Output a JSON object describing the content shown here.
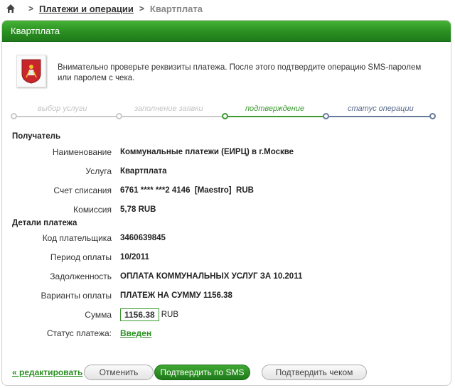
{
  "breadcrumb": {
    "link": "Платежи и операции",
    "current": "Квартплата",
    "separator": ">"
  },
  "panel": {
    "title": "Квартплата",
    "info": "Внимательно проверьте реквизиты платежа. После этого подтвердите операцию SMS-паролем или паролем с чека."
  },
  "steps": [
    {
      "label": "выбор услуги",
      "state": "done"
    },
    {
      "label": "заполнение заявки",
      "state": "done"
    },
    {
      "label": "подтверждение",
      "state": "active"
    },
    {
      "label": "статус операции",
      "state": "pending"
    }
  ],
  "recipient": {
    "title": "Получатель",
    "fields": [
      {
        "label": "Наименование",
        "value": "Коммунальные платежи (ЕИРЦ) в г.Москве"
      },
      {
        "label": "Услуга",
        "value": "Квартплата"
      },
      {
        "label": "Счет списания",
        "value": "6761 **** ***2 4146  [Maestro]  RUB"
      },
      {
        "label": "Комиссия",
        "value": "5,78 RUB"
      }
    ]
  },
  "details": {
    "title": "Детали платежа",
    "fields": [
      {
        "label": "Код плательщика",
        "value": "3460639845"
      },
      {
        "label": "Период оплаты",
        "value": "10/2011"
      },
      {
        "label": "Задолженность",
        "value": "ОПЛАТА КОММУНАЛЬНЫХ УСЛУГ ЗА 10.2011"
      },
      {
        "label": "Варианты оплаты",
        "value": "ПЛАТЕЖ НА СУММУ 1156.38"
      }
    ],
    "sum_label": "Сумма",
    "sum_value": "1156.38",
    "sum_currency": "RUB",
    "status_label": "Статус платежа:",
    "status_value": "Введен"
  },
  "footer": {
    "edit": "« редактировать",
    "cancel": "Отменить",
    "confirm_sms": "Подтвердить по SMS",
    "confirm_check": "Подтвердить чеком"
  },
  "colors": {
    "accent": "#2a8f22",
    "step_done": "#c9c9c9",
    "step_active": "#3a9a2e",
    "step_pending": "#667a99"
  }
}
